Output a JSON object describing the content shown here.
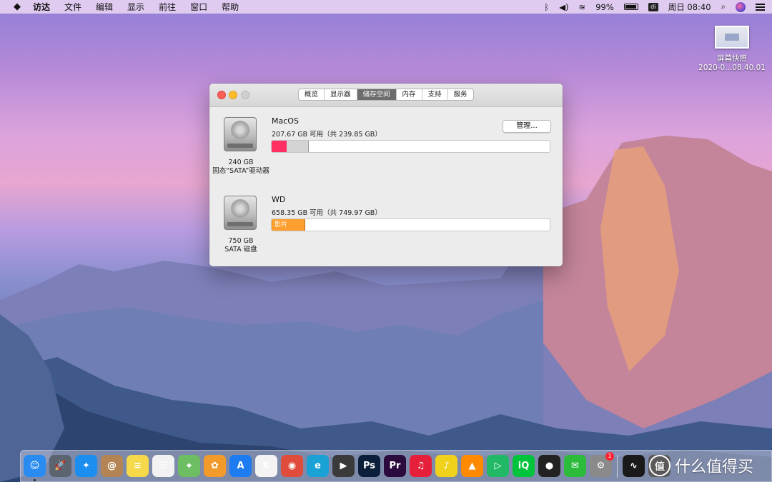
{
  "menubar": {
    "items": [
      "访达",
      "文件",
      "编辑",
      "显示",
      "前往",
      "窗口",
      "帮助"
    ],
    "battery": "99%",
    "clock": "周日 08:40"
  },
  "desktop_icon": {
    "label_line1": "屏幕快照",
    "label_line2": "2020-0...08.40.01"
  },
  "window": {
    "tabs": [
      "概览",
      "显示器",
      "储存空间",
      "内存",
      "支持",
      "服务"
    ],
    "active_tab": "储存空间",
    "disks": [
      {
        "name": "MacOS",
        "available": "207.67 GB 可用（共 239.85 GB）",
        "capacity": "240 GB",
        "type": "固态“SATA”驱动器",
        "manage_label": "管理...",
        "usage_fraction": 0.134
      },
      {
        "name": "WD",
        "available": "658.35 GB 可用（共 749.97 GB）",
        "capacity": "750 GB",
        "type": "SATA 磁盘",
        "segment_label": "影片",
        "usage_fraction": 0.122
      }
    ]
  },
  "dock": {
    "badge_count": "1",
    "apps": [
      {
        "icon": "finder-icon",
        "glyph": "☺",
        "color": "#2a8cf0"
      },
      {
        "icon": "launchpad-icon",
        "glyph": "🚀",
        "color": "#5c6470"
      },
      {
        "icon": "safari-icon",
        "glyph": "✦",
        "color": "#1c8ef0"
      },
      {
        "icon": "contacts-icon",
        "glyph": "@",
        "color": "#b48454"
      },
      {
        "icon": "notes-icon",
        "glyph": "≡",
        "color": "#f6d94b"
      },
      {
        "icon": "reminders-icon",
        "glyph": "☰",
        "color": "#f2f2f2"
      },
      {
        "icon": "maps-icon",
        "glyph": "⌖",
        "color": "#6dbd63"
      },
      {
        "icon": "photos-icon",
        "glyph": "✿",
        "color": "#f29b2a"
      },
      {
        "icon": "app-store-icon",
        "glyph": "A",
        "color": "#1d7cf2"
      },
      {
        "icon": "keynote-like-icon",
        "glyph": "K",
        "color": "#f3f3f3"
      },
      {
        "icon": "chrome-icon",
        "glyph": "◉",
        "color": "#e04c3c"
      },
      {
        "icon": "edge-icon",
        "glyph": "e",
        "color": "#1aa2d6"
      },
      {
        "icon": "final-cut-icon",
        "glyph": "▶",
        "color": "#3a3a3a"
      },
      {
        "icon": "photoshop-icon",
        "glyph": "Ps",
        "color": "#0b1f3a"
      },
      {
        "icon": "premiere-icon",
        "glyph": "Pr",
        "color": "#2b0a3d"
      },
      {
        "icon": "netease-music-icon",
        "glyph": "♫",
        "color": "#e6203a"
      },
      {
        "icon": "qq-music-icon",
        "glyph": "♪",
        "color": "#f0d21c"
      },
      {
        "icon": "vlc-icon",
        "glyph": "▲",
        "color": "#ff8a00"
      },
      {
        "icon": "tencent-video-icon",
        "glyph": "▷",
        "color": "#21b866"
      },
      {
        "icon": "iqiyi-icon",
        "glyph": "iQ",
        "color": "#00c43c"
      },
      {
        "icon": "qq-icon",
        "glyph": "●",
        "color": "#222222"
      },
      {
        "icon": "wechat-icon",
        "glyph": "✉",
        "color": "#2dbb3c"
      },
      {
        "icon": "system-preferences-icon",
        "glyph": "⚙",
        "color": "#8a8a8a"
      },
      {
        "icon": "activity-monitor-icon",
        "glyph": "∿",
        "color": "#1a1a1a"
      },
      {
        "icon": "disk-utility-icon",
        "glyph": "▤",
        "color": "#5a5a5a"
      }
    ]
  },
  "watermark": {
    "logo": "值",
    "text": "什么值得买"
  }
}
